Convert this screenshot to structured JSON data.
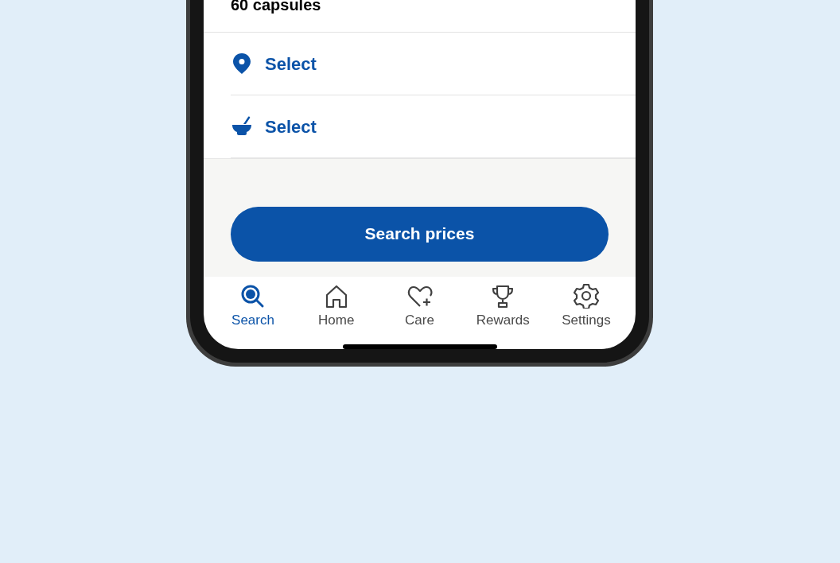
{
  "quantity": "60 capsules",
  "selectors": [
    {
      "kind": "location",
      "label": "Select"
    },
    {
      "kind": "pharmacy",
      "label": "Select"
    }
  ],
  "primary_button": "Search prices",
  "nav": [
    {
      "kind": "search",
      "label": "Search",
      "selected": true
    },
    {
      "kind": "home",
      "label": "Home",
      "selected": false
    },
    {
      "kind": "care",
      "label": "Care",
      "selected": false
    },
    {
      "kind": "rewards",
      "label": "Rewards",
      "selected": false
    },
    {
      "kind": "settings",
      "label": "Settings",
      "selected": false
    }
  ]
}
